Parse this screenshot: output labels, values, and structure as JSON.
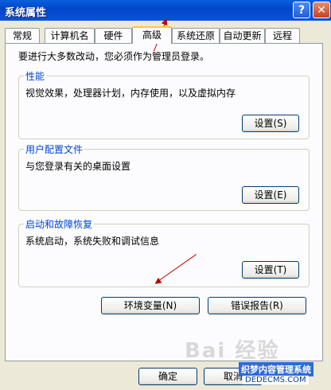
{
  "window": {
    "title": "系统属性",
    "help": "?",
    "close": "✕"
  },
  "tabs": [
    {
      "label": "常规"
    },
    {
      "label": "计算机名"
    },
    {
      "label": "硬件"
    },
    {
      "label": "高级"
    },
    {
      "label": "系统还原"
    },
    {
      "label": "自动更新"
    },
    {
      "label": "远程"
    }
  ],
  "panel": {
    "note": "要进行大多数改动，您必须作为管理员登录。",
    "performance": {
      "title": "性能",
      "desc": "视觉效果，处理器计划，内存使用，以及虚拟内存",
      "button": "设置(S)"
    },
    "profiles": {
      "title": "用户配置文件",
      "desc": "与您登录有关的桌面设置",
      "button": "设置(E)"
    },
    "startup": {
      "title": "启动和故障恢复",
      "desc": "系统启动，系统失败和调试信息",
      "button": "设置(T)"
    },
    "env_button": "环境变量(N)",
    "error_button": "错误报告(R)"
  },
  "footer": {
    "ok": "确定",
    "cancel": "取消"
  },
  "watermark": {
    "baidu": "Bai 经验",
    "site": "织梦内容管理系统",
    "url": "DEDECMS.COM"
  }
}
